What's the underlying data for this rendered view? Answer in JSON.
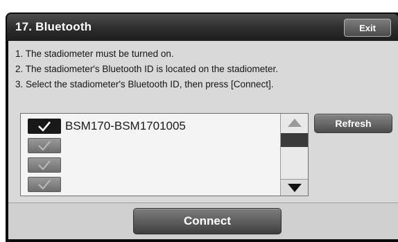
{
  "window": {
    "title": "17. Bluetooth",
    "exit_label": "Exit"
  },
  "instructions": [
    "1. The stadiometer must be turned on.",
    "2. The stadiometer's Bluetooth ID is located on the stadiometer.",
    "3. Select the stadiometer's Bluetooth ID, then press [Connect]."
  ],
  "device_list": {
    "items": [
      {
        "label": "BSM170-BSM1701005",
        "checked": true
      },
      {
        "label": "",
        "checked": false
      },
      {
        "label": "",
        "checked": false
      },
      {
        "label": "",
        "checked": false
      }
    ]
  },
  "buttons": {
    "refresh_label": "Refresh",
    "connect_label": "Connect"
  },
  "icons": {
    "scroll_up": "triangle-up-icon",
    "scroll_down": "triangle-down-icon",
    "check": "checkmark-icon"
  }
}
